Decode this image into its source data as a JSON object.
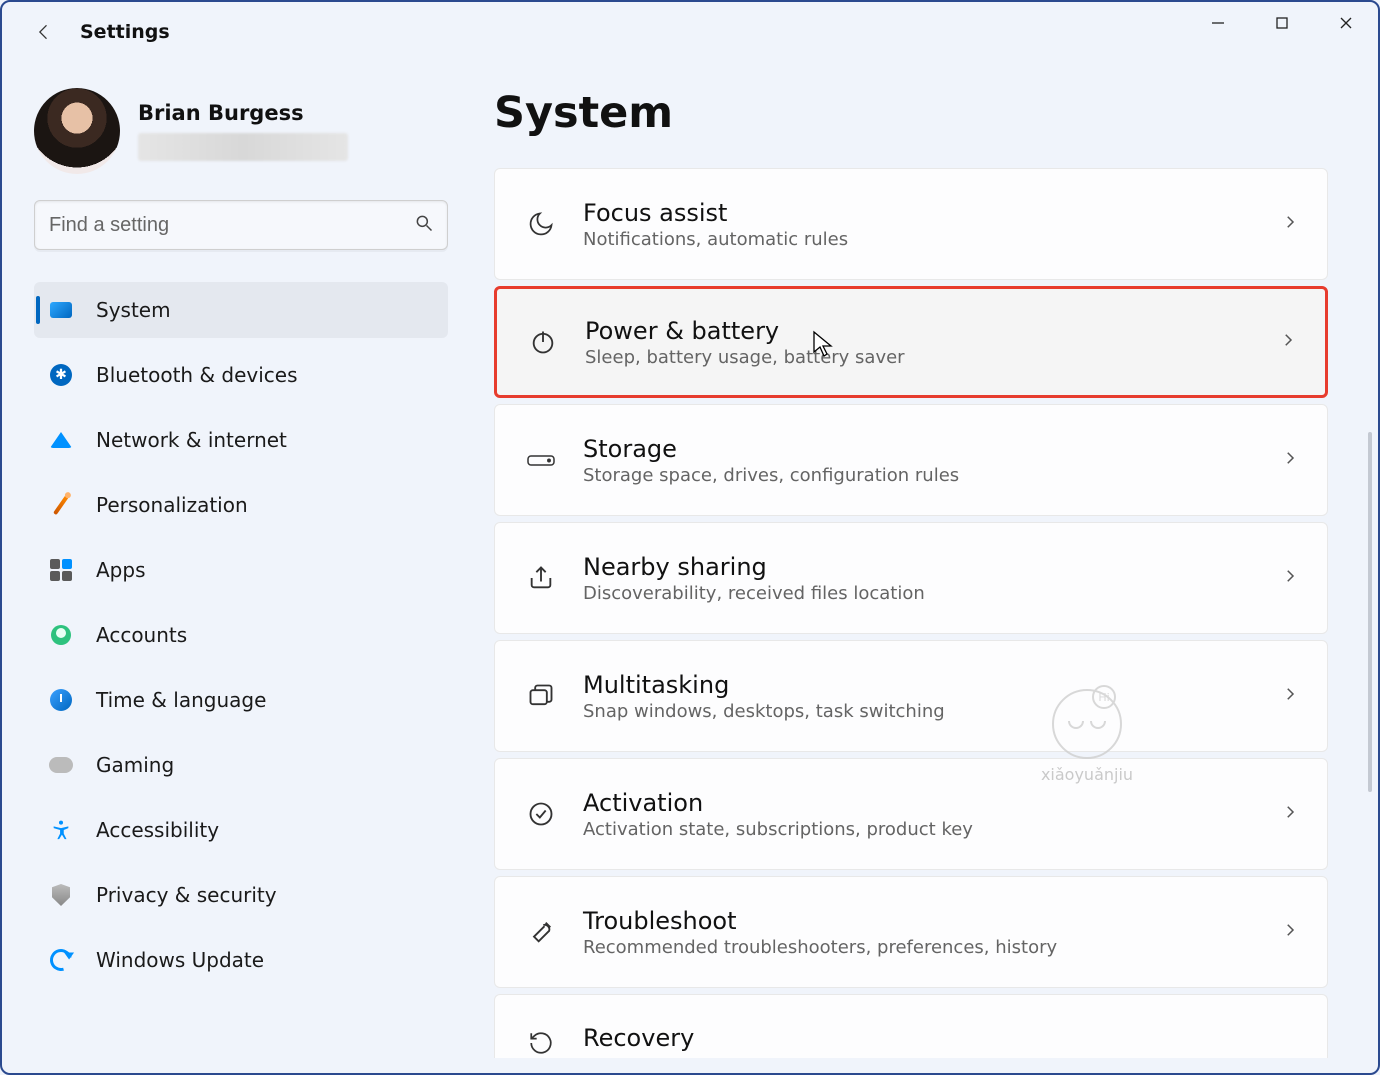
{
  "app_title": "Settings",
  "user": {
    "name": "Brian Burgess"
  },
  "search": {
    "placeholder": "Find a setting"
  },
  "sidebar": {
    "items": [
      {
        "label": "System",
        "selected": true
      },
      {
        "label": "Bluetooth & devices"
      },
      {
        "label": "Network & internet"
      },
      {
        "label": "Personalization"
      },
      {
        "label": "Apps"
      },
      {
        "label": "Accounts"
      },
      {
        "label": "Time & language"
      },
      {
        "label": "Gaming"
      },
      {
        "label": "Accessibility"
      },
      {
        "label": "Privacy & security"
      },
      {
        "label": "Windows Update"
      }
    ]
  },
  "main": {
    "heading": "System",
    "cards": [
      {
        "title": "Focus assist",
        "sub": "Notifications, automatic rules"
      },
      {
        "title": "Power & battery",
        "sub": "Sleep, battery usage, battery saver",
        "highlight": true
      },
      {
        "title": "Storage",
        "sub": "Storage space, drives, configuration rules"
      },
      {
        "title": "Nearby sharing",
        "sub": "Discoverability, received files location"
      },
      {
        "title": "Multitasking",
        "sub": "Snap windows, desktops, task switching"
      },
      {
        "title": "Activation",
        "sub": "Activation state, subscriptions, product key"
      },
      {
        "title": "Troubleshoot",
        "sub": "Recommended troubleshooters, preferences, history"
      },
      {
        "title": "Recovery",
        "sub": ""
      }
    ]
  },
  "watermark": {
    "text": "xiǎoyuǎnjiu",
    "bubble": "Hi"
  }
}
